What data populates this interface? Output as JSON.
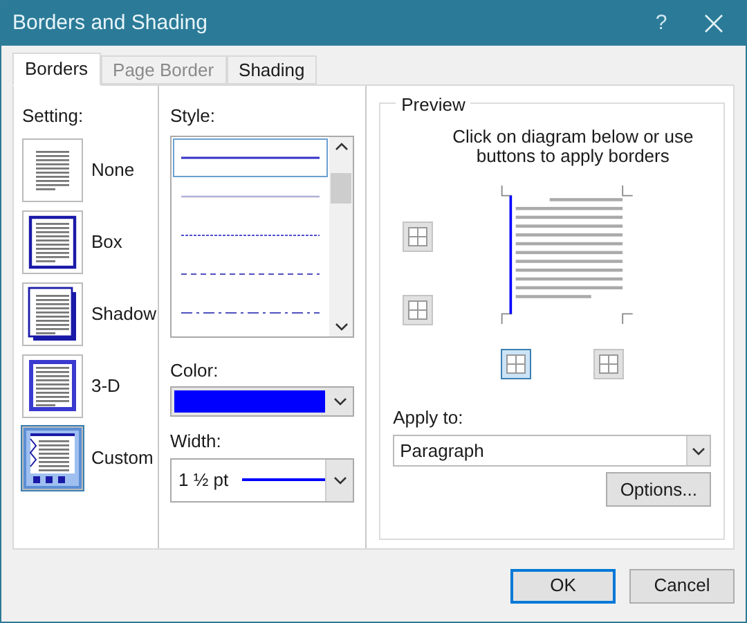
{
  "window": {
    "title": "Borders and Shading",
    "help": "?"
  },
  "tabs": [
    {
      "label": "Borders",
      "selected": true
    },
    {
      "label": "Page Border",
      "selected": false,
      "disabled": true
    },
    {
      "label": "Shading",
      "selected": false,
      "disabled": false
    }
  ],
  "setting": {
    "label": "Setting:",
    "items": [
      {
        "label": "None",
        "kind": "none",
        "selected": false
      },
      {
        "label": "Box",
        "kind": "box",
        "selected": false
      },
      {
        "label": "Shadow",
        "kind": "shadow",
        "selected": false
      },
      {
        "label": "3-D",
        "kind": "threed",
        "selected": false
      },
      {
        "label": "Custom",
        "kind": "custom",
        "selected": true
      }
    ]
  },
  "style": {
    "label": "Style:",
    "items": [
      {
        "kind": "solid",
        "selected": true
      },
      {
        "kind": "thin",
        "selected": false
      },
      {
        "kind": "dotted",
        "selected": false
      },
      {
        "kind": "dashed",
        "selected": false
      },
      {
        "kind": "dashdot",
        "selected": false
      }
    ]
  },
  "color": {
    "label": "Color:",
    "color": "#0000ff"
  },
  "width": {
    "label": "Width:",
    "value": "1 ½ pt"
  },
  "preview": {
    "label": "Preview",
    "hint": "Click on diagram below or use buttons to apply borders",
    "borders": [
      {
        "kind": "top",
        "selected": false
      },
      {
        "kind": "bottom",
        "selected": false
      },
      {
        "kind": "left",
        "selected": true
      },
      {
        "kind": "right",
        "selected": false
      }
    ]
  },
  "apply_to": {
    "label": "Apply to:",
    "value": "Paragraph"
  },
  "buttons": [
    {
      "label": "Options...",
      "kind": "options"
    },
    {
      "label": "OK",
      "kind": "default"
    },
    {
      "label": "Cancel",
      "kind": "normal"
    }
  ]
}
